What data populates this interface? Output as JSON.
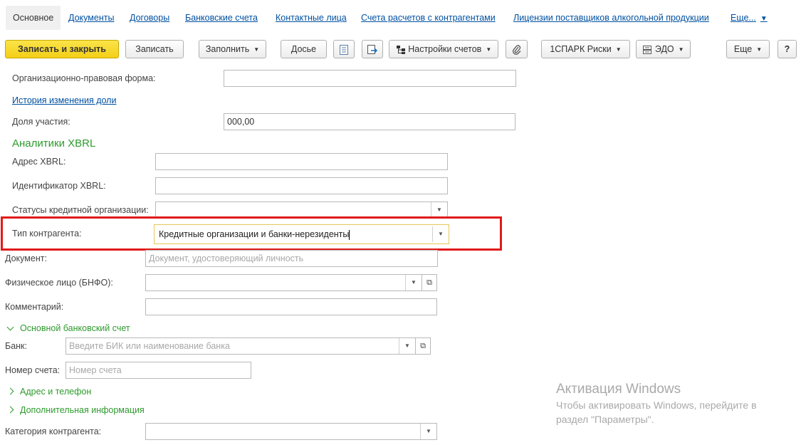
{
  "tabs": {
    "main": "Основное",
    "documents": "Документы",
    "contracts": "Договоры",
    "bank_accounts": "Банковские счета",
    "contacts": "Контактные лица",
    "settlement_accounts": "Счета расчетов с контрагентами",
    "licenses": "Лицензии поставщиков алкогольной продукции",
    "more": "Еще..."
  },
  "toolbar": {
    "save_close": "Записать и закрыть",
    "save": "Записать",
    "fill": "Заполнить",
    "dossier": "Досье",
    "account_settings": "Настройки счетов",
    "spark": "1СПАРК Риски",
    "edo": "ЭДО",
    "more": "Еще",
    "help": "?"
  },
  "form": {
    "org_form_label": "Организационно-правовая форма:",
    "org_form_value": "",
    "share_history_link": "История изменения доли",
    "share_label": "Доля участия:",
    "share_value": "000,00",
    "xbrl_section": "Аналитики XBRL",
    "xbrl_address_label": "Адрес XBRL:",
    "xbrl_address_value": "",
    "xbrl_id_label": "Идентификатор XBRL:",
    "xbrl_id_value": "",
    "credit_status_label": "Статусы кредитной организации:",
    "credit_status_value": "",
    "counterparty_type_label": "Тип контрагента:",
    "counterparty_type_value": "Кредитные организации и банки-нерезиденты",
    "document_label": "Документ:",
    "document_placeholder": "Документ, удостоверяющий личность",
    "person_label": "Физическое лицо (БНФО):",
    "person_value": "",
    "comment_label": "Комментарий:",
    "comment_value": "",
    "bank_account_group": "Основной банковский счет",
    "bank_label": "Банк:",
    "bank_placeholder": "Введите БИК или наименование банка",
    "account_number_label": "Номер счета:",
    "account_number_placeholder": "Номер счета",
    "address_group": "Адрес и телефон",
    "additional_group": "Дополнительная информация",
    "category_label": "Категория контрагента:",
    "category_value": ""
  },
  "watermark": {
    "title": "Активация Windows",
    "line1": "Чтобы активировать Windows, перейдите в",
    "line2": "раздел \"Параметры\"."
  },
  "colors": {
    "accent_yellow": "#f5d31d",
    "link_blue": "#0050a0",
    "section_green": "#2e9a2e",
    "highlight_red": "#e11a1a"
  }
}
